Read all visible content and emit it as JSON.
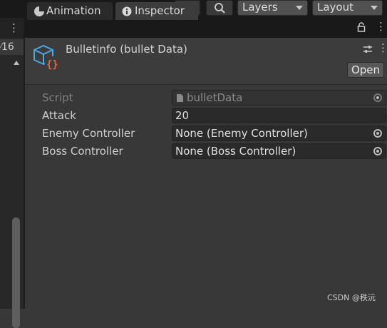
{
  "toolbar": {
    "history_icon": "history-icon",
    "search_icon": "search-icon",
    "layers_label": "Layers",
    "layout_label": "Layout"
  },
  "left_panel": {
    "count": "16"
  },
  "tabs": [
    {
      "label": "Animation",
      "icon": "animation-icon"
    },
    {
      "label": "Inspector",
      "icon": "info-icon"
    }
  ],
  "inspector": {
    "object_title": "Bulletinfo (bullet Data)",
    "open_label": "Open",
    "fields": [
      {
        "label": "Script",
        "value": "bulletData",
        "disabled": true
      },
      {
        "label": "Attack",
        "value": "20"
      },
      {
        "label": "Enemy Controller",
        "value": "None (Enemy Controller)"
      },
      {
        "label": "Boss Controller",
        "value": "None (Boss Controller)"
      }
    ]
  },
  "watermark": "CSDN @秩沅"
}
